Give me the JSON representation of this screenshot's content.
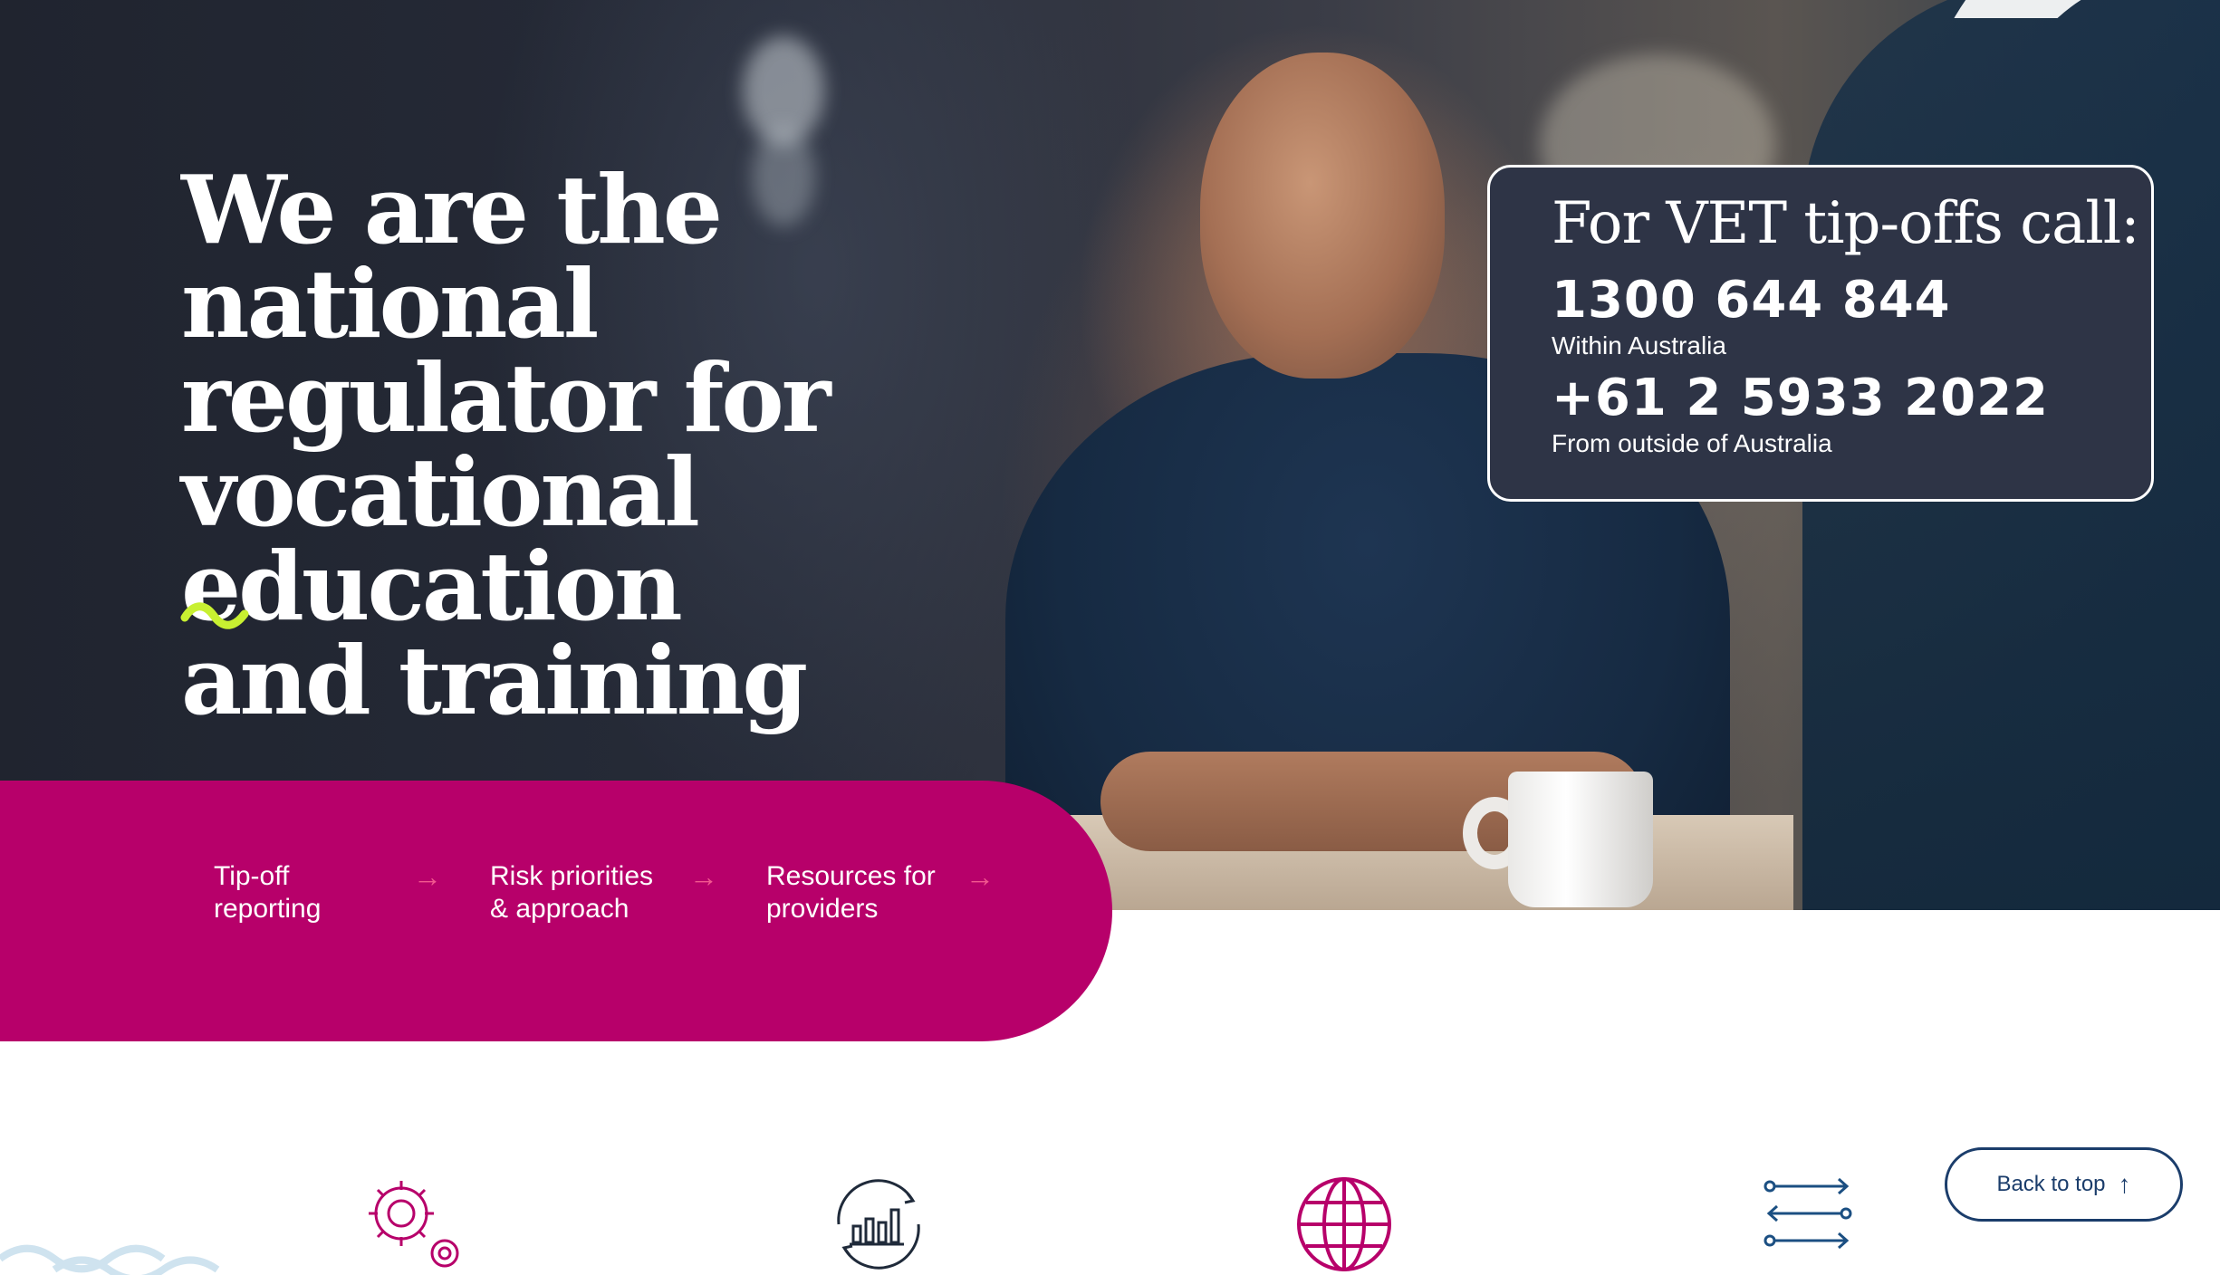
{
  "hero": {
    "title_lines": [
      "We are the national",
      "regulator for",
      "vocational education",
      "and training"
    ]
  },
  "tipoff": {
    "heading": "For VET tip-offs call:",
    "phone_domestic": "1300 644 844",
    "phone_domestic_note": "Within Australia",
    "phone_international": "+61 2 5933 2022",
    "phone_international_note": "From outside of Australia"
  },
  "quick_links": [
    {
      "label": "Tip-off reporting",
      "arrow": "→"
    },
    {
      "label": "Risk priorities & approach",
      "arrow": "→"
    },
    {
      "label": "Resources for providers",
      "arrow": "→"
    }
  ],
  "feature_icons": [
    "gears-icon",
    "chart-cycle-icon",
    "globe-icon",
    "exchange-arrows-icon"
  ],
  "back_to_top": {
    "label": "Back to top",
    "arrow": "↑"
  },
  "colors": {
    "magenta": "#b7006a",
    "navy": "#1b3d6b",
    "tip_box_bg": "#2e3446",
    "accent_lime": "#c8f031",
    "arrow_pink": "#f2578f"
  }
}
